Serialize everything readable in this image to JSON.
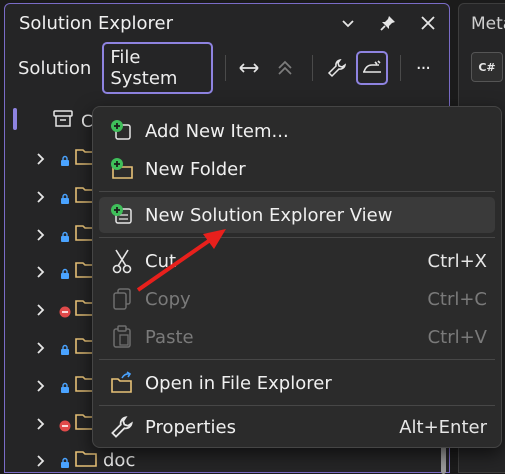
{
  "panel": {
    "title": "Solution Explorer",
    "toolbar": {
      "solution_tab": "Solution",
      "file_system_tab": "File System",
      "more": "···"
    }
  },
  "tree": {
    "root_label": "C",
    "rows": [
      {
        "badge": "lock",
        "label": ""
      },
      {
        "badge": "lock",
        "label": ""
      },
      {
        "badge": "lock",
        "label": ""
      },
      {
        "badge": "lock",
        "label": ""
      },
      {
        "badge": "minus",
        "label": ""
      },
      {
        "badge": "lock",
        "label": ""
      },
      {
        "badge": "lock",
        "label": ""
      },
      {
        "badge": "minus",
        "label": ""
      },
      {
        "badge": "lock",
        "label": "doc"
      }
    ]
  },
  "right_panel": {
    "title": "Meta",
    "tab_icon": "C#"
  },
  "context_menu": {
    "items": [
      {
        "label": "Add New Item...",
        "shortcut": "",
        "icon": "add-new-item-icon",
        "disabled": false
      },
      {
        "label": "New Folder",
        "shortcut": "",
        "icon": "new-folder-icon",
        "disabled": false
      },
      {
        "label": "New Solution Explorer View",
        "shortcut": "",
        "icon": "new-view-icon",
        "disabled": false
      },
      {
        "label": "Cut",
        "shortcut": "Ctrl+X",
        "icon": "scissors-icon",
        "disabled": false
      },
      {
        "label": "Copy",
        "shortcut": "Ctrl+C",
        "icon": "copy-icon",
        "disabled": true
      },
      {
        "label": "Paste",
        "shortcut": "Ctrl+V",
        "icon": "paste-icon",
        "disabled": true
      },
      {
        "label": "Open in File Explorer",
        "shortcut": "",
        "icon": "open-folder-icon",
        "disabled": false
      },
      {
        "label": "Properties",
        "shortcut": "Alt+Enter",
        "icon": "wrench-icon",
        "disabled": false
      }
    ],
    "highlighted": "New Solution Explorer View"
  },
  "colors": {
    "accent": "#8e83e0",
    "folder": "#e8c277",
    "lock": "#4aa3ff",
    "minus": "#e04a4a",
    "plus_badge": "#3fbf5a",
    "arrow": "#e8201c"
  }
}
